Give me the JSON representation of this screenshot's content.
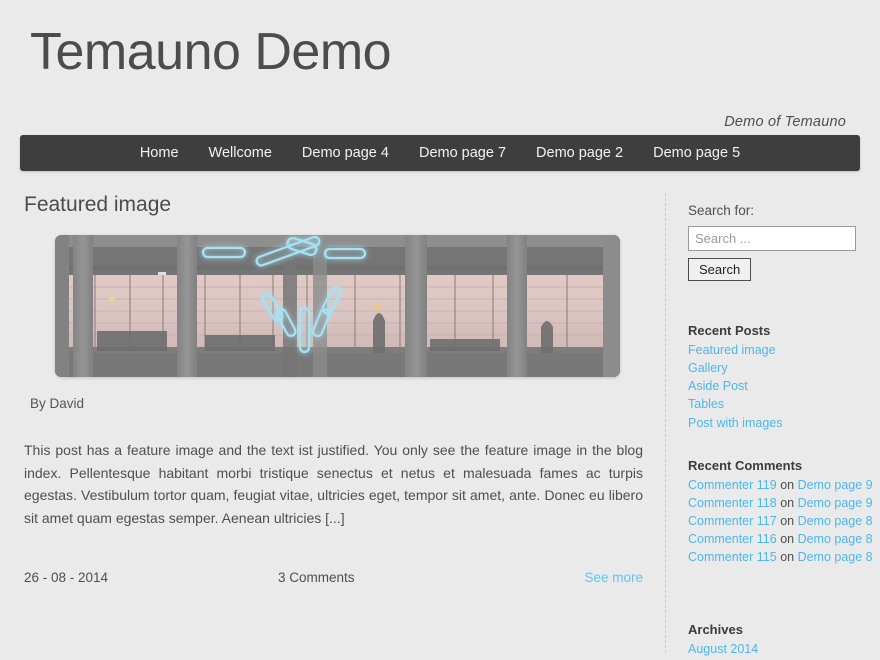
{
  "site": {
    "title": "Temauno Demo",
    "tagline": "Demo of Temauno"
  },
  "nav": {
    "items": [
      {
        "label": "Home"
      },
      {
        "label": "Wellcome"
      },
      {
        "label": "Demo page 4"
      },
      {
        "label": "Demo page 7"
      },
      {
        "label": "Demo page 2"
      },
      {
        "label": "Demo page 5"
      }
    ]
  },
  "post": {
    "title": "Featured image",
    "byline": "By David",
    "excerpt": "This post has a feature image and the text ist justified. You only see the feature image in the blog index. Pellentesque habitant morbi tristique senectus et netus et malesuada fames ac turpis egestas. Vestibulum tortor quam, feugiat vitae, ultricies eget, tempor sit amet, ante. Donec eu libero sit amet quam egestas semper. Aenean ultricies [...]",
    "date": "26 - 08 - 2014",
    "comments": "3 Comments",
    "more_label": "See more",
    "featured_image_alt": "Dark industrial loft interior with pink sunset windows and cyan neon light tubes"
  },
  "sidebar": {
    "search": {
      "label": "Search for:",
      "placeholder": "Search ...",
      "value": "",
      "button_label": "Search"
    },
    "recent_posts": {
      "title": "Recent Posts",
      "items": [
        {
          "label": "Featured image"
        },
        {
          "label": "Gallery"
        },
        {
          "label": "Aside Post"
        },
        {
          "label": "Tables"
        },
        {
          "label": "Post with images"
        }
      ]
    },
    "recent_comments": {
      "title": "Recent Comments",
      "separator": "on",
      "items": [
        {
          "author": "Commenter 119",
          "target": "Demo page 9"
        },
        {
          "author": "Commenter 118",
          "target": "Demo page 9"
        },
        {
          "author": "Commenter 117",
          "target": "Demo page 8"
        },
        {
          "author": "Commenter 116",
          "target": "Demo page 8"
        },
        {
          "author": "Commenter 115",
          "target": "Demo page 8"
        }
      ]
    },
    "archives": {
      "title": "Archives",
      "items": [
        {
          "label": "August 2014"
        }
      ]
    }
  },
  "colors": {
    "page_background": "#eaeaea",
    "nav_background": "#3e3e3e",
    "link": "#4cb7ee",
    "accent_link": "#59c6f5",
    "text": "#4f4f4f",
    "heading": "#4c4c4c"
  }
}
